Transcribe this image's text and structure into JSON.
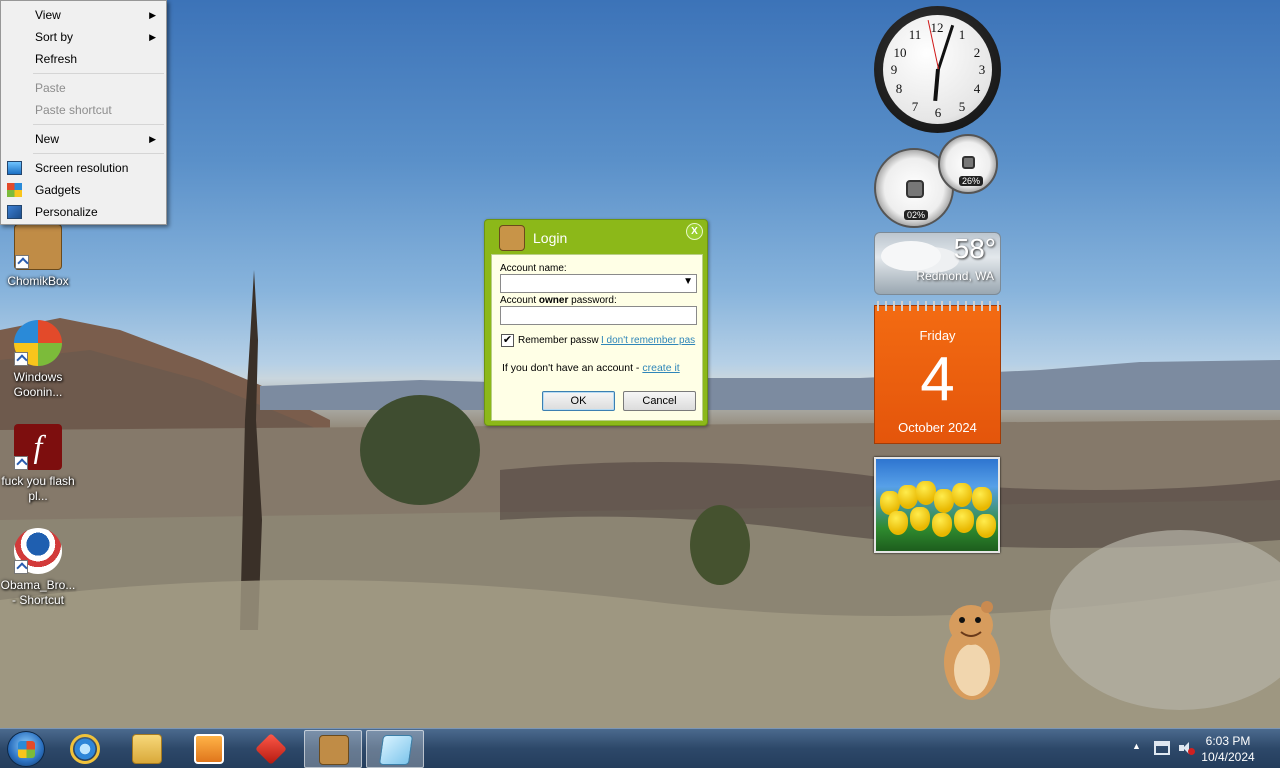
{
  "context_menu": {
    "items": [
      {
        "label": "View",
        "submenu": true,
        "disabled": false
      },
      {
        "label": "Sort by",
        "submenu": true,
        "disabled": false
      },
      {
        "label": "Refresh",
        "submenu": false,
        "disabled": false
      },
      {
        "label": "Paste",
        "submenu": false,
        "disabled": true
      },
      {
        "label": "Paste shortcut",
        "submenu": false,
        "disabled": true
      },
      {
        "label": "New",
        "submenu": true,
        "disabled": false
      },
      {
        "label": "Screen resolution",
        "icon": "monitor-icon"
      },
      {
        "label": "Gadgets",
        "icon": "gadgets-icon"
      },
      {
        "label": "Personalize",
        "icon": "personalize-icon"
      }
    ],
    "arrow_glyph": "▶"
  },
  "desktop_icons": [
    {
      "label": "ChomikBox",
      "icon": "chomikbox-icon"
    },
    {
      "label": "Windows Goonin...",
      "icon": "windows-logo-icon"
    },
    {
      "label": "fuck you flash pl...",
      "icon": "flash-icon"
    },
    {
      "label": "Obama_Bro... - Shortcut",
      "icon": "obama-logo-icon"
    }
  ],
  "login_dialog": {
    "title": "Login",
    "close_label": "X",
    "account_label": "Account name:",
    "account_value": "",
    "password_label_pre": "Account ",
    "password_label_bold": "owner",
    "password_label_post": " password:",
    "password_value": "",
    "remember_label": "Remember passw",
    "remember_checked": true,
    "check_glyph": "✔",
    "forgot_link": "I don't remember pas",
    "no_account_text": "If you don't have an account - ",
    "create_link": "create it",
    "ok_label": "OK",
    "cancel_label": "Cancel",
    "dropdown_glyph": "▼"
  },
  "gadgets": {
    "clock": {
      "numbers": [
        "12",
        "1",
        "2",
        "3",
        "4",
        "5",
        "6",
        "7",
        "8",
        "9",
        "10",
        "11"
      ]
    },
    "cpu_meter": {
      "cpu_percent": "02%",
      "memory_percent": "26%"
    },
    "weather": {
      "temperature": "58°",
      "location": "Redmond, WA"
    },
    "calendar": {
      "weekday": "Friday",
      "day": "4",
      "month_year": "October 2024"
    }
  },
  "taskbar": {
    "items": [
      {
        "name": "internet-explorer",
        "icon": "ie-icon"
      },
      {
        "name": "file-explorer",
        "icon": "folder-icon"
      },
      {
        "name": "media-player",
        "icon": "media-player-icon"
      },
      {
        "name": "red-app",
        "icon": "red-box-icon"
      },
      {
        "name": "chomikbox",
        "icon": "chomikbox-icon",
        "active": true
      },
      {
        "name": "notepad-app",
        "icon": "notepad-icon",
        "active": true
      }
    ],
    "time": "6:03 PM",
    "date": "10/4/2024",
    "tray_up_glyph": "▲"
  },
  "colors": {
    "login_green": "#8cb819",
    "calendar_orange": "#f36b12",
    "taskbar": "#2d4869"
  }
}
